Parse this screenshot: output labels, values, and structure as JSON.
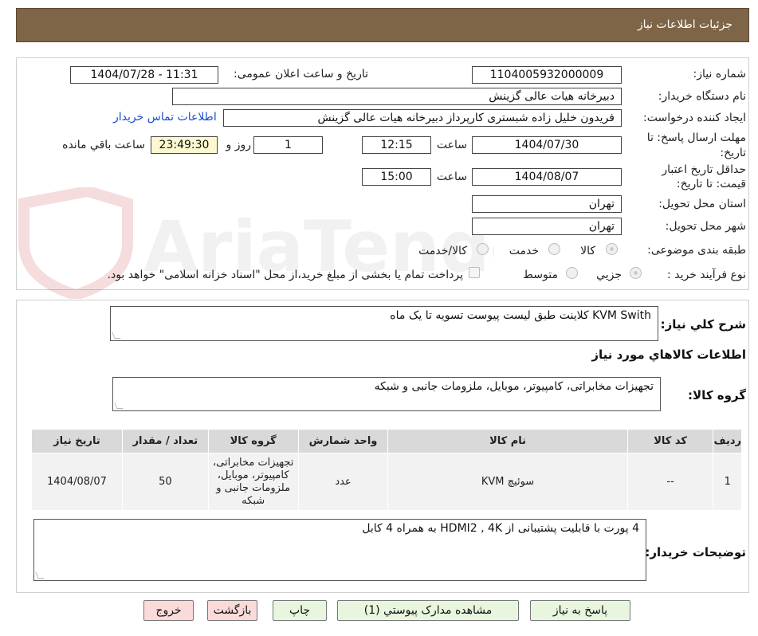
{
  "header": {
    "title": "جزئیات اطلاعات نیاز"
  },
  "form": {
    "need_number_label": "شماره نیاز:",
    "need_number": "1104005932000009",
    "announce_label": "تاریخ و ساعت اعلان عمومی:",
    "announce_value": "1404/07/28 - 11:31",
    "buyer_org_label": "نام دستگاه خریدار:",
    "buyer_org": "دبیرخانه هیات عالی گزینش",
    "creator_label": "ایجاد کننده درخواست:",
    "creator": "فریدون  خلیل زاده شبستری  کارپرداز دبیرخانه هیات عالی گزینش",
    "contact_link": "اطلاعات تماس خریدار",
    "deadline_label_1": "مهلت ارسال پاسخ: تا",
    "deadline_label_2": "تاریخ:",
    "deadline_date": "1404/07/30",
    "time_label": "ساعت",
    "deadline_time": "12:15",
    "days": "1",
    "days_label": "روز و",
    "remaining_time": "23:49:30",
    "remaining_label": "ساعت باقي مانده",
    "validity_label_1": "حداقل تاریخ اعتبار",
    "validity_label_2": "قیمت: تا تاریخ:",
    "validity_date": "1404/08/07",
    "validity_time": "15:00",
    "province_label": "استان محل تحویل:",
    "province": "تهران",
    "city_label": "شهر محل تحویل:",
    "city": "تهران",
    "category_label": "طبقه بندی موضوعی:",
    "category_options": [
      "کالا",
      "خدمت",
      "کالا/خدمت"
    ],
    "process_label": "نوع فرآیند خرید :",
    "process_options": [
      "جزیي",
      "متوسط"
    ],
    "payment_note": "پرداخت تمام یا بخشی از مبلغ خرید،از محل \"اسناد خزانه اسلامی\" خواهد بود."
  },
  "summary": {
    "label": "شرح كلي نياز:",
    "text": "KVM Swith کلاینت طبق لیست پیوست تسویه تا یک ماه"
  },
  "goods_section": {
    "title": "اطلاعات كالاهاي مورد نياز",
    "group_label": "گروه کالا:",
    "group_value": "تجهیزات مخابراتی، کامپیوتر، موبایل، ملزومات جانبی و شبکه"
  },
  "table": {
    "headers": [
      "ردیف",
      "کد کالا",
      "نام کالا",
      "واحد شمارش",
      "گروه کالا",
      "تعداد / مقدار",
      "تاریخ نیاز"
    ],
    "rows": [
      [
        "1",
        "--",
        "سوئیچ KVM",
        "عدد",
        "تجهیزات مخابراتی، کامپیوتر، موبایل، ملزومات جانبی و شبکه",
        "50",
        "1404/08/07"
      ]
    ]
  },
  "buyer_notes": {
    "label": "توضیحات خریدار:",
    "text": "4 پورت با قابلیت پشتیبانی از HDMI2 , 4K به همراه 4 کابل"
  },
  "buttons": {
    "reply": "پاسخ به نیاز",
    "attachments": "مشاهده مدارک پیوستي (1)",
    "print": "چاپ",
    "back": "بازگشت",
    "exit": "خروج"
  },
  "watermark": {
    "text": "AriaTender.neT"
  },
  "colors": {
    "header": "#7e6547",
    "link": "#1a4fd1",
    "remaining_bg": "#fdf8cf"
  }
}
